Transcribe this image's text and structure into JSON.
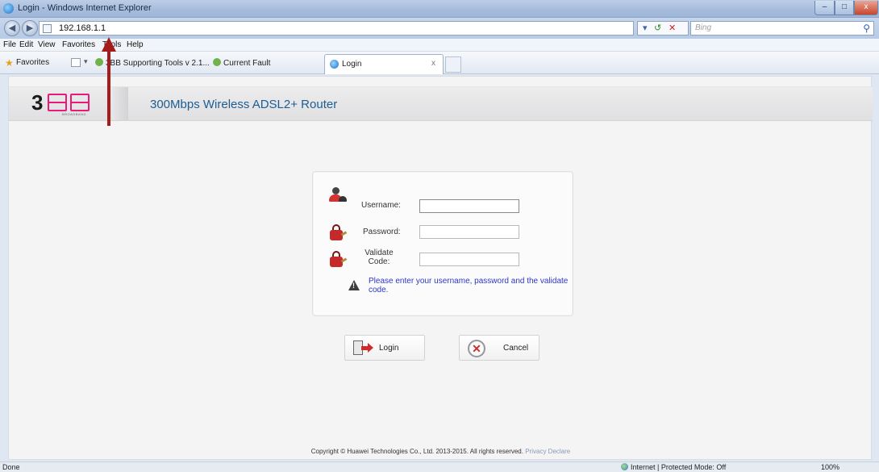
{
  "window": {
    "title": "Login - Windows Internet Explorer",
    "minimize_glyph": "–",
    "maximize_glyph": "□",
    "close_glyph": "x"
  },
  "address_bar": {
    "back_glyph": "◀",
    "forward_glyph": "▶",
    "url": "192.168.1.1",
    "refresh_glyph": "↺",
    "stop_glyph": "✕",
    "search_engine": "Bing",
    "search_icon": "magnifier-icon"
  },
  "menu": [
    "File",
    "Edit",
    "View",
    "Favorites",
    "Tools",
    "Help"
  ],
  "favorites_bar": {
    "label": "Favorites",
    "dropdown_glyph": "▾",
    "links": [
      "3BB Supporting Tools v 2.1...",
      "Current Fault"
    ],
    "active_tab": {
      "title": "Login",
      "close_glyph": "x"
    }
  },
  "page": {
    "logo_text": "3",
    "logo_subtext": "BROADBAND",
    "router_title": "300Mbps Wireless ADSL2+ Router",
    "login": {
      "username_label": "Username:",
      "username_value": "",
      "password_label": "Password:",
      "password_value": "",
      "validate_label": "Validate Code:",
      "validate_value": "",
      "hint": "Please enter your username, password and the validate code."
    },
    "buttons": {
      "login": "Login",
      "cancel": "Cancel",
      "cancel_glyph": "✕"
    },
    "copyright": "Copyright © Huawei Technologies Co., Ltd. 2013-2015. All rights reserved.",
    "privacy_link": "Privacy Declare"
  },
  "status_bar": {
    "left": "Done",
    "zone": "Internet | Protected Mode: Off",
    "zoom": "100%"
  },
  "colors": {
    "brand_pink": "#ea1a7a",
    "title_blue": "#1d5d92",
    "hint_blue": "#2d37c8",
    "annotation_red": "#a61b1b"
  }
}
